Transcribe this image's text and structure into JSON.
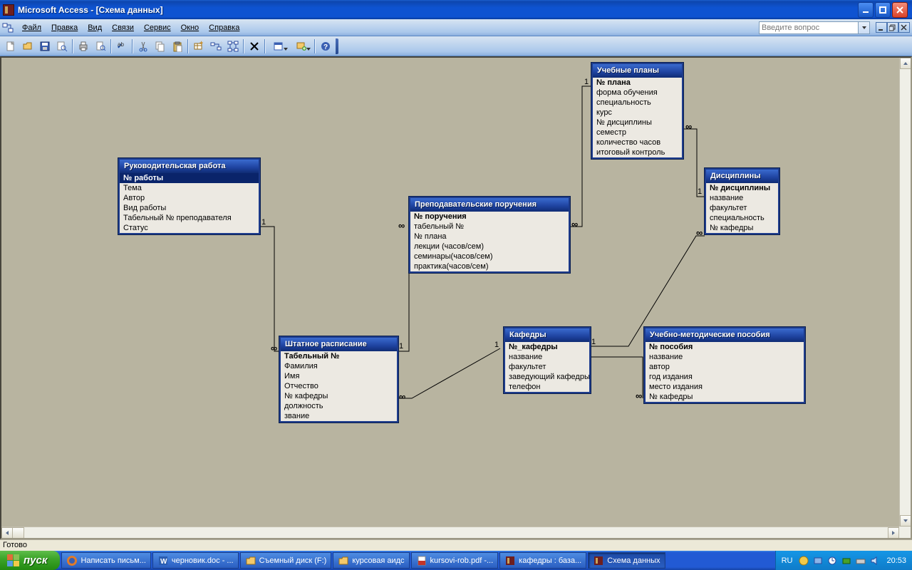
{
  "titlebar": {
    "title": "Microsoft Access - [Схема данных]"
  },
  "menu": {
    "items": [
      "Файл",
      "Правка",
      "Вид",
      "Связи",
      "Сервис",
      "Окно",
      "Справка"
    ],
    "help_placeholder": "Введите вопрос"
  },
  "tables": {
    "rukovod": {
      "title": "Руководительская работа",
      "fields": [
        "№ работы",
        "Тема",
        "Автор",
        "Вид работы",
        "Табельный № преподавателя",
        "Статус"
      ],
      "pk": 0,
      "selected": 0
    },
    "shtat": {
      "title": "Штатное расписание",
      "fields": [
        "Табельный №",
        "Фамилия",
        "Имя",
        "Отчество",
        "№ кафедры",
        "должность",
        "звание"
      ],
      "pk": 0
    },
    "prepod": {
      "title": "Преподавательские поручения",
      "fields": [
        "№ поручения",
        "табельный №",
        "№ плана",
        "лекции (часов/сем)",
        "семинары(часов/сем)",
        "практика(часов/сем)"
      ],
      "pk": 0
    },
    "ucheb_plan": {
      "title": "Учебные планы",
      "fields": [
        "№ плана",
        "форма обучения",
        "специальность",
        "курс",
        "№ дисциплины",
        "семестр",
        "количество часов",
        "итоговый контроль"
      ],
      "pk": 0
    },
    "kafedry": {
      "title": "Кафедры",
      "fields": [
        "№_кафедры",
        "название",
        "факультет",
        "заведующий кафедры",
        "телефон"
      ],
      "pk": 0
    },
    "discipliny": {
      "title": "Дисциплины",
      "fields": [
        "№ дисциплины",
        "название",
        "факультет",
        "специальность",
        "№ кафедры"
      ],
      "pk": 0
    },
    "posobiya": {
      "title": "Учебно-методические пособия",
      "fields": [
        "№ пособия",
        "название",
        "автор",
        "год издания",
        "место издания",
        "№  кафедры"
      ],
      "pk": 0
    }
  },
  "labels": {
    "one": "1",
    "inf": "∞"
  },
  "status": "Готово",
  "taskbar": {
    "start": "пуск",
    "items": [
      {
        "label": "Написать письм...",
        "icon": "firefox"
      },
      {
        "label": "черновик.doc - ...",
        "icon": "word"
      },
      {
        "label": "Съемный диск (F:)",
        "icon": "folder"
      },
      {
        "label": "курсовая аидс",
        "icon": "folder"
      },
      {
        "label": "kursovi-rob.pdf -...",
        "icon": "pdf"
      },
      {
        "label": "кафедры : база...",
        "icon": "access"
      },
      {
        "label": "Схема данных",
        "icon": "access",
        "active": true
      }
    ],
    "lang": "RU",
    "time": "20:53"
  }
}
